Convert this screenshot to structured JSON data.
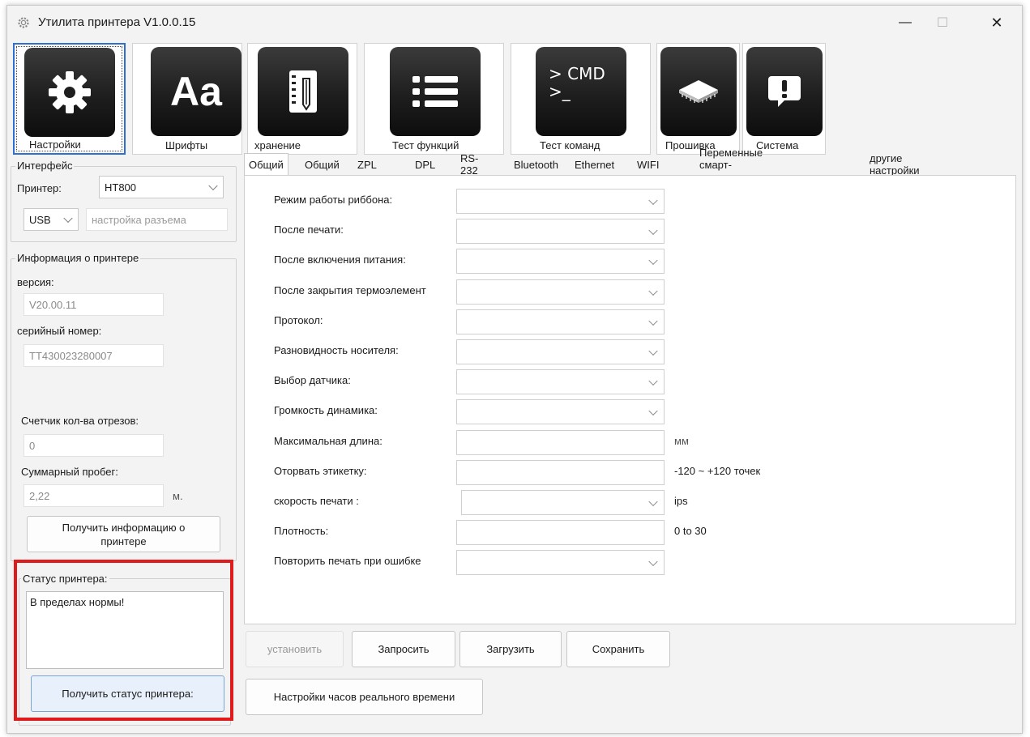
{
  "window": {
    "title": "Утилита принтера  V1.0.0.15",
    "minimize_glyph": "—",
    "maximize_glyph": "☐",
    "close_glyph": "✕"
  },
  "toolbar": [
    {
      "label": "Настройки",
      "icon": "gear-icon"
    },
    {
      "label": "Шрифты",
      "icon": "font-icon",
      "icon_text": "Aa"
    },
    {
      "label": "хранение",
      "icon": "storage-notebook-icon"
    },
    {
      "label": "Тест функций",
      "icon": "list-icon"
    },
    {
      "label": "Тест команд",
      "icon": "cmd-icon",
      "icon_text": "> CMD\n>_"
    },
    {
      "label": "Прошивка",
      "icon": "chip-icon"
    },
    {
      "label": "Система",
      "icon": "alert-icon"
    }
  ],
  "interface": {
    "group_title": "Интерфейс",
    "printer_label": "Принтер:",
    "printer_value": "HT800",
    "port_value": "USB",
    "port_settings_button": "настройка разъема"
  },
  "printer_info": {
    "group_title": "Информация о принтере",
    "version_label": "версия:",
    "version_value": "V20.00.11",
    "serial_label": "серийный номер:",
    "serial_value": "TT430023280007",
    "cut_counter_label": "Счетчик кол-ва отрезов:",
    "cut_counter_value": "0",
    "mileage_label": "Суммарный пробег:",
    "mileage_value": "2,22",
    "mileage_unit": "м.",
    "get_info_button": "Получить информацию о принтере"
  },
  "status": {
    "group_title": "Статус принтера:",
    "text": "В пределах нормы!",
    "get_status_button": "Получить статус принтера:",
    "highlight_color": "#e01b1b"
  },
  "tabs": [
    "Общий",
    "Общий",
    "ZPL",
    "DPL",
    "RS-232",
    "Bluetooth",
    "Ethernet",
    "WIFI",
    "Переменные смарт-печати",
    "другие настройки"
  ],
  "settings": {
    "rows": [
      {
        "label": "Режим работы риббона:",
        "type": "combo",
        "value": "",
        "suffix": ""
      },
      {
        "label": "После печати:",
        "type": "combo",
        "value": "",
        "suffix": ""
      },
      {
        "label": "После включения питания:",
        "type": "combo",
        "value": "",
        "suffix": ""
      },
      {
        "label": "После закрытия термоэлемент",
        "type": "combo",
        "value": "",
        "suffix": ""
      },
      {
        "label": "Протокол:",
        "type": "combo",
        "value": "",
        "suffix": ""
      },
      {
        "label": "Разновидность носителя:",
        "type": "combo",
        "value": "",
        "suffix": ""
      },
      {
        "label": "Выбор датчика:",
        "type": "combo",
        "value": "",
        "suffix": ""
      },
      {
        "label": "Громкость динамика:",
        "type": "combo",
        "value": "",
        "suffix": ""
      },
      {
        "label": "Максимальная длина:",
        "type": "input",
        "value": "",
        "suffix": "мм"
      },
      {
        "label": "Оторвать этикетку:",
        "type": "input",
        "value": "",
        "suffix": "-120 ~ +120 точек"
      },
      {
        "label": "скорость печати :",
        "type": "combo",
        "value": "",
        "suffix": "ips"
      },
      {
        "label": "Плотность:",
        "type": "input",
        "value": "",
        "suffix": "0 to 30"
      },
      {
        "label": "Повторить печать при ошибке",
        "type": "combo",
        "value": "",
        "suffix": ""
      }
    ]
  },
  "actions": {
    "set_button": "установить",
    "query_button": "Запросить",
    "load_button": "Загрузить",
    "save_button": "Сохранить",
    "rtc_button": "Настройки часов реального времени"
  }
}
